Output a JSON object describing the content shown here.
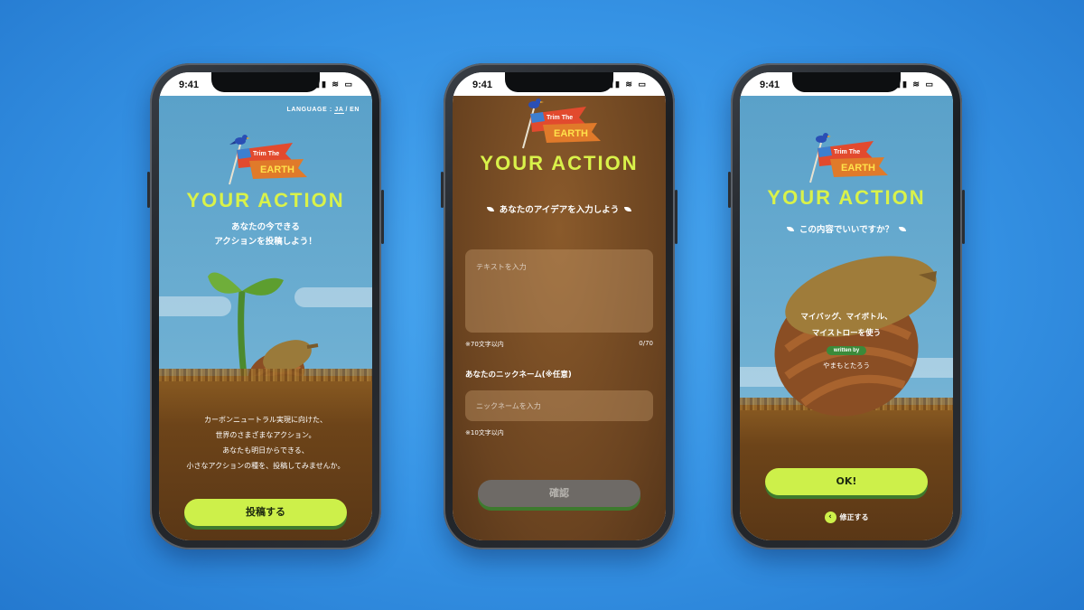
{
  "status": {
    "time": "9:41"
  },
  "logo": {
    "line1": "Trim The",
    "line2": "EARTH"
  },
  "headline": "YOUR ACTION",
  "screen1": {
    "lang_prefix": "LANGUAGE :",
    "lang_ja": "JA",
    "lang_sep": "/",
    "lang_en": "EN",
    "subtitle_line1": "あなたの今できる",
    "subtitle_line2": "アクションを投稿しよう！",
    "desc": [
      "カーボンニュートラル実現に向けた、",
      "世界のさまざまなアクション。",
      "あなたも明日からできる、",
      "小さなアクションの種を、投稿してみませんか。"
    ],
    "submit_button": "投稿する"
  },
  "screen2": {
    "heading": "あなたのアイデアを入力しよう",
    "text_placeholder": "テキストを入力",
    "text_hint": "※70文字以内",
    "text_counter": "0/70",
    "nickname_label": "あなたのニックネーム(※任意)",
    "nickname_placeholder": "ニックネームを入力",
    "nickname_hint": "※10文字以内",
    "confirm_button": "確認"
  },
  "screen3": {
    "heading": "この内容でいいですか？",
    "action_line1": "マイバッグ、マイボトル、",
    "action_line2": "マイストローを使う",
    "written_by": "written by",
    "author": "やまもとたろう",
    "ok_button": "OK!",
    "edit_link": "修正する"
  },
  "colors": {
    "accent_lime": "#cdf04a",
    "headline_lime": "#d9f24a",
    "button_shadow_green": "#3e7a2e",
    "sky_blue": "#6fb0d3",
    "soil_brown": "#6a4320",
    "background_blue": "#3592e4"
  },
  "icons": [
    "bird-icon",
    "flag-icon",
    "leaf-icon",
    "chevron-left-icon",
    "wifi-icon",
    "battery-icon",
    "signal-icon"
  ]
}
